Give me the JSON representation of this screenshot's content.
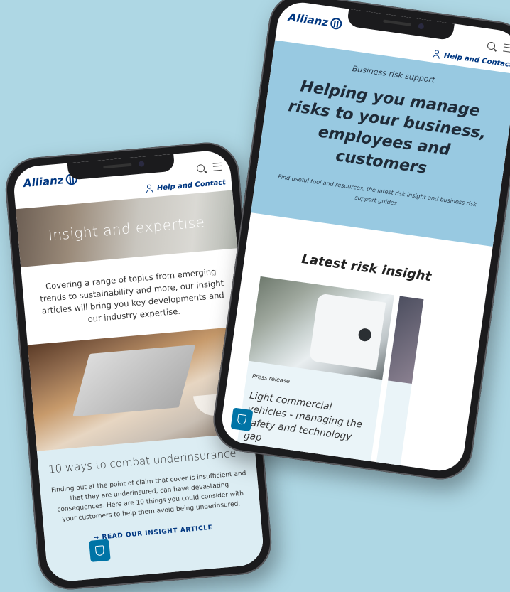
{
  "brand": {
    "logo_text": "Allianz"
  },
  "phone_left": {
    "help_label": "Help and Contact",
    "hero_title": "Insight and expertise",
    "intro": "Covering a range of topics from emerging trends to sustainability and more, our insight articles will bring you key developments and our industry expertise.",
    "card": {
      "title": "10 ways to combat underinsurance",
      "body": "Finding out at the point of claim that cover is insufficient and that they are underinsured, can have devastating consequences. Here are 10 things you could consider with your customers to help them avoid being underinsured.",
      "cta": "→ READ OUR INSIGHT ARTICLE"
    }
  },
  "phone_right": {
    "help_label": "Help and Contact",
    "hero_kicker": "Business risk support",
    "hero_title": "Helping you manage risks to your business, employees and customers",
    "hero_sub": "Find useful tool and resources, the latest risk insight and business risk support guides",
    "section_title": "Latest risk insight",
    "cards": [
      {
        "label": "Press release",
        "title": "Light commercial vehicles - managing the safety and technology gap"
      }
    ]
  },
  "colors": {
    "brand_blue": "#003781",
    "background": "#aed7e4",
    "hero_blue": "#98c9e1",
    "badge_blue": "#0074a6"
  }
}
